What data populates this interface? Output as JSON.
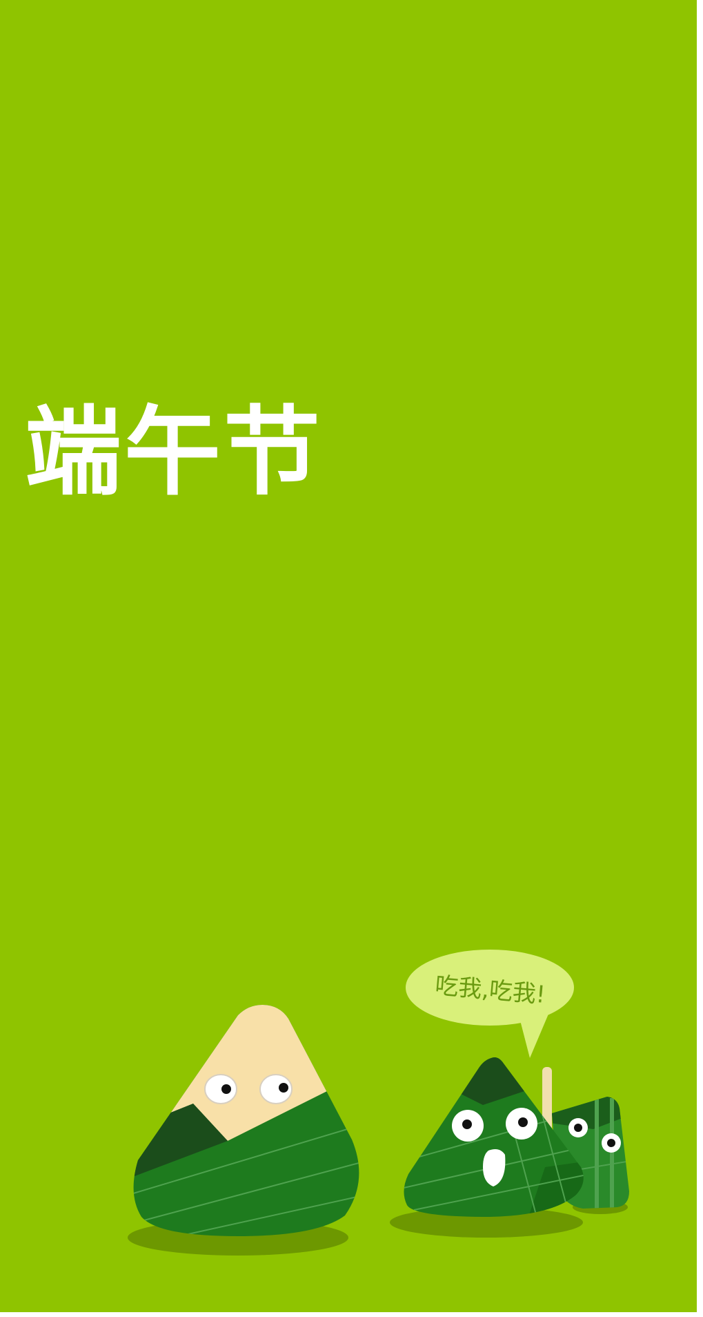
{
  "poster": {
    "title": "端午节",
    "speech_bubble": "吃我,吃我!",
    "background_color": "#8fc400"
  }
}
